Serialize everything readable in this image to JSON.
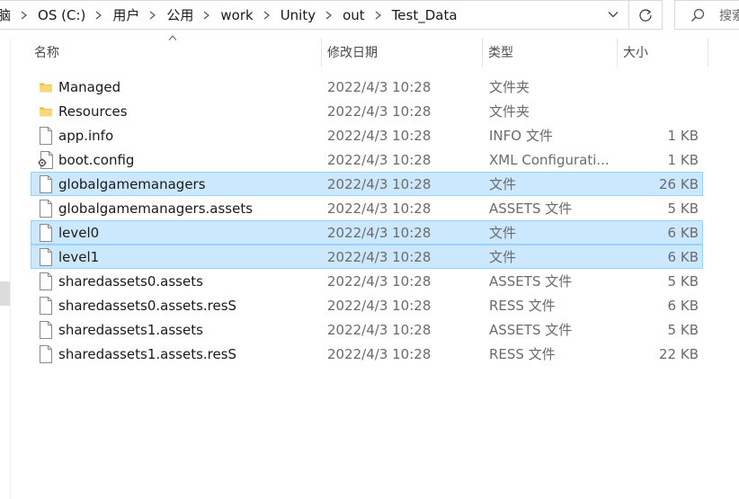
{
  "address_bar": {
    "crumbs": [
      "脑",
      "OS (C:)",
      "用户",
      "公用",
      "work",
      "Unity",
      "out",
      "Test_Data"
    ]
  },
  "search": {
    "placeholder": "搜索"
  },
  "columns": {
    "name": "名称",
    "date": "修改日期",
    "type": "类型",
    "size": "大小"
  },
  "files": [
    {
      "name": "Managed",
      "date": "2022/4/3 10:28",
      "type": "文件夹",
      "size": "",
      "icon": "folder-icon",
      "selected": false
    },
    {
      "name": "Resources",
      "date": "2022/4/3 10:28",
      "type": "文件夹",
      "size": "",
      "icon": "folder-icon",
      "selected": false
    },
    {
      "name": "app.info",
      "date": "2022/4/3 10:28",
      "type": "INFO 文件",
      "size": "1 KB",
      "icon": "file-icon",
      "selected": false
    },
    {
      "name": "boot.config",
      "date": "2022/4/3 10:28",
      "type": "XML Configurati...",
      "size": "1 KB",
      "icon": "config-file-icon",
      "selected": false
    },
    {
      "name": "globalgamemanagers",
      "date": "2022/4/3 10:28",
      "type": "文件",
      "size": "26 KB",
      "icon": "file-icon",
      "selected": true
    },
    {
      "name": "globalgamemanagers.assets",
      "date": "2022/4/3 10:28",
      "type": "ASSETS 文件",
      "size": "5 KB",
      "icon": "file-icon",
      "selected": false
    },
    {
      "name": "level0",
      "date": "2022/4/3 10:28",
      "type": "文件",
      "size": "6 KB",
      "icon": "file-icon",
      "selected": true
    },
    {
      "name": "level1",
      "date": "2022/4/3 10:28",
      "type": "文件",
      "size": "6 KB",
      "icon": "file-icon",
      "selected": true
    },
    {
      "name": "sharedassets0.assets",
      "date": "2022/4/3 10:28",
      "type": "ASSETS 文件",
      "size": "5 KB",
      "icon": "file-icon",
      "selected": false
    },
    {
      "name": "sharedassets0.assets.resS",
      "date": "2022/4/3 10:28",
      "type": "RESS 文件",
      "size": "6 KB",
      "icon": "file-icon",
      "selected": false
    },
    {
      "name": "sharedassets1.assets",
      "date": "2022/4/3 10:28",
      "type": "ASSETS 文件",
      "size": "5 KB",
      "icon": "file-icon",
      "selected": false
    },
    {
      "name": "sharedassets1.assets.resS",
      "date": "2022/4/3 10:28",
      "type": "RESS 文件",
      "size": "22 KB",
      "icon": "file-icon",
      "selected": false
    }
  ],
  "colors": {
    "selection_bg": "#cce8ff",
    "selection_border": "#99d1ff",
    "folder": "#f8d775"
  }
}
